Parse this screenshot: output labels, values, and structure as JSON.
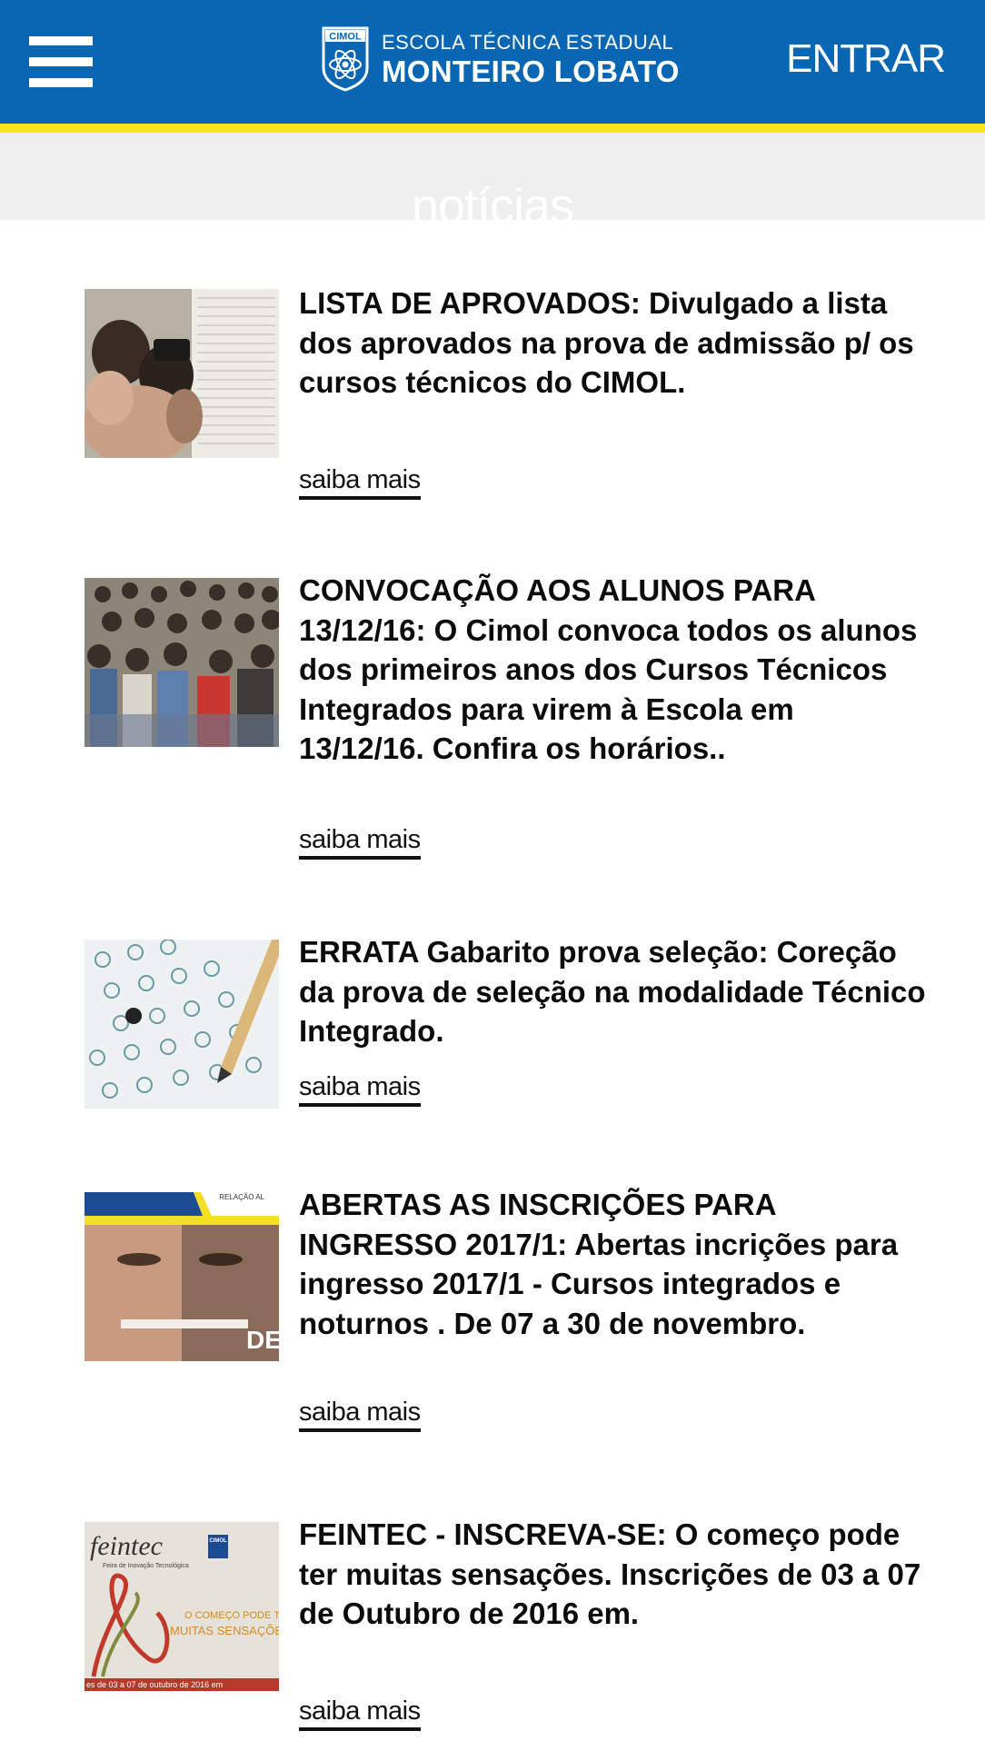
{
  "header": {
    "menu_icon": "hamburger-menu-icon",
    "logo": {
      "badge_text": "CIMOL",
      "line1": "ESCOLA TÉCNICA ESTADUAL",
      "line2": "MONTEIRO LOBATO"
    },
    "login_label": "ENTRAR",
    "colors": {
      "header_bg": "#0866b3",
      "stripe": "#f8e51c",
      "section_bar": "#efefef"
    }
  },
  "section": {
    "title": "notícias"
  },
  "news": [
    {
      "title": "LISTA DE APROVADOS: Divulgado a lista dos aprovados na prova de admissão p/ os cursos técnicos do CIMOL.",
      "more": "saiba mais"
    },
    {
      "title": "CONVOCAÇÃO AOS ALUNOS PARA 13/12/16: O Cimol convoca todos os alunos dos primeiros anos dos Cursos Técnicos Integrados para virem à Escola em 13/12/16. Confira os horários..",
      "more": "saiba mais"
    },
    {
      "title": "ERRATA Gabarito prova seleção: Coreção da prova de seleção na modalidade Técnico Integrado.",
      "more": "saiba mais"
    },
    {
      "title": "ABERTAS AS INSCRIÇÕES PARA INGRESSO 2017/1: Abertas incrições para ingresso 2017/1 - Cursos integrados e noturnos . De 07 a 30 de novembro.",
      "more": "saiba mais",
      "thumb_texts": {
        "corner": "RELAÇÃO AL",
        "big": "DE"
      }
    },
    {
      "title": "FEINTEC - INSCREVA-SE: O começo pode ter muitas sensações. Inscrições de 03 a 07 de Outubro de 2016 em.",
      "more": "saiba mais",
      "thumb_texts": {
        "logo": "feintec",
        "subtitle": "Feira de Inovação Tecnológica",
        "slogan1": "O COMEÇO PODE TER",
        "slogan2": "MUITAS SENSAÇÕES",
        "dates": "es de 03 a 07 de outubro de 2016 em",
        "badge": "CIMOL"
      }
    }
  ]
}
